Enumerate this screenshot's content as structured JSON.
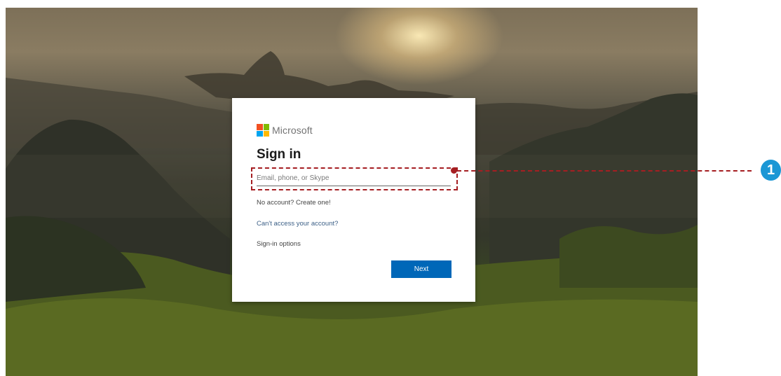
{
  "brand": {
    "name": "Microsoft",
    "logo_colors": [
      "#f25022",
      "#7fba00",
      "#00a4ef",
      "#ffb900"
    ]
  },
  "signin": {
    "title": "Sign in",
    "email_placeholder": "Email, phone, or Skype",
    "email_value": "",
    "no_account_link": "No account? Create one!",
    "cant_access_link": "Can't access your account?",
    "signin_options_link": "Sign-in options",
    "next_button": "Next"
  },
  "callout": {
    "number": "1",
    "color": "#a51e22",
    "badge_color": "#1b97d5"
  },
  "colors": {
    "accent": "#0067b8",
    "link": "#3b5f86"
  }
}
